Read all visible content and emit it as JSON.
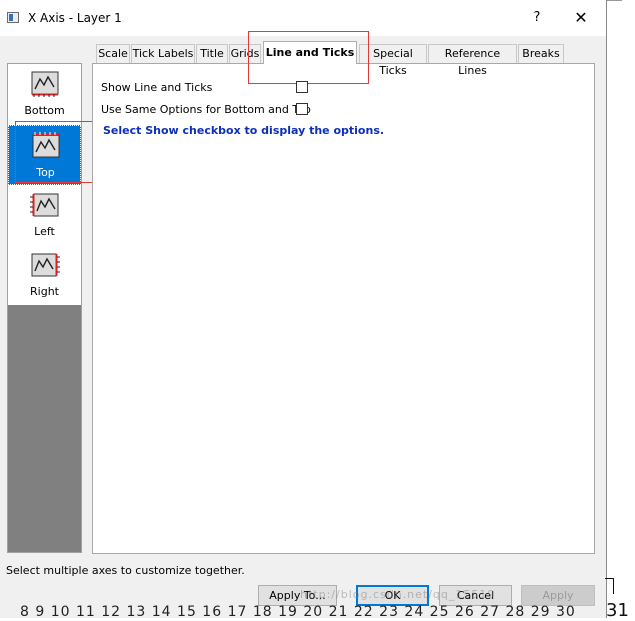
{
  "window": {
    "title": "X Axis - Layer 1",
    "help_glyph": "?",
    "close_glyph": "✕"
  },
  "axes": [
    {
      "label": "Bottom",
      "selected": false,
      "icon": "axis-bottom-icon"
    },
    {
      "label": "Top",
      "selected": true,
      "icon": "axis-top-icon"
    },
    {
      "label": "Left",
      "selected": false,
      "icon": "axis-left-icon"
    },
    {
      "label": "Right",
      "selected": false,
      "icon": "axis-right-icon"
    }
  ],
  "tabs": [
    {
      "label": "Scale",
      "active": false
    },
    {
      "label": "Tick Labels",
      "active": false
    },
    {
      "label": "Title",
      "active": false
    },
    {
      "label": "Grids",
      "active": false
    },
    {
      "label": "Line and Ticks",
      "active": true
    },
    {
      "label": "Special Ticks",
      "active": false
    },
    {
      "label": "Reference Lines",
      "active": false
    },
    {
      "label": "Breaks",
      "active": false
    }
  ],
  "options": {
    "show_line_label": "Show Line and Ticks",
    "show_line_checked": false,
    "same_options_label": "Use Same Options for Bottom and Top",
    "same_options_checked": false,
    "hint": "Select Show checkbox to display the options."
  },
  "status_text": "Select multiple axes to customize together.",
  "buttons": {
    "apply_to": "Apply To...",
    "ok": "OK",
    "cancel": "Cancel",
    "apply": "Apply"
  },
  "watermark": "http://blog.csdn.net/qq_15519",
  "background": {
    "digits": "8  9 10 11 12 13 14 15 16 17 18 19 20 21 22 23 24 25 26 27 28 29 30",
    "number": "31"
  },
  "colors": {
    "selection": "#0078d7",
    "hint_text": "#0b2fb8",
    "annotation": "#e03a3a"
  }
}
